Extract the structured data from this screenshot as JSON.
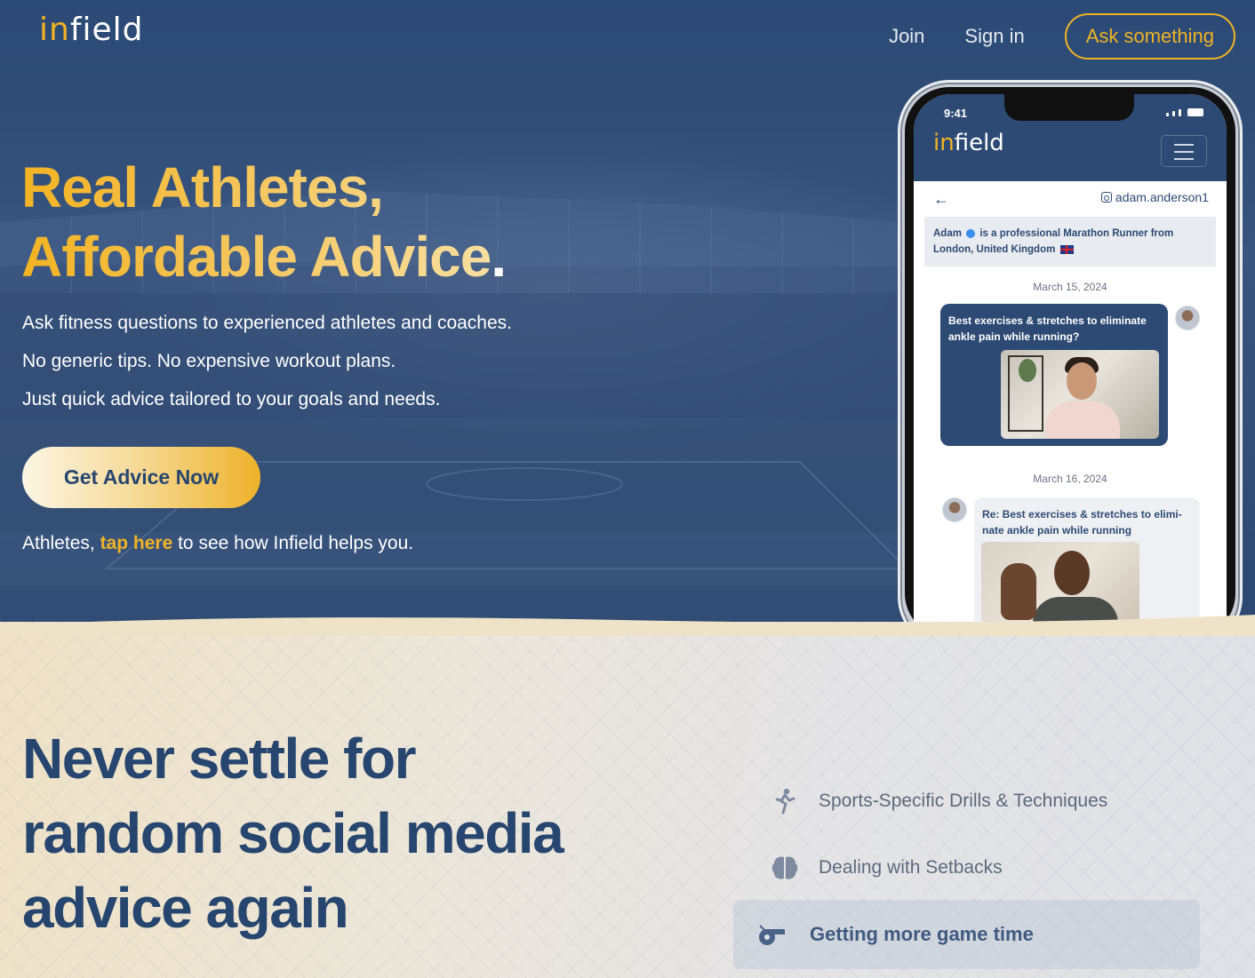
{
  "brand": {
    "logo_prefix": "in",
    "logo_rest": "field",
    "accent": "#f0b326",
    "navy": "#27466f"
  },
  "nav": {
    "join": "Join",
    "signin": "Sign in",
    "ask": "Ask something"
  },
  "hero": {
    "headline_line1": "Real Athletes,",
    "headline_line2": "Affordable Advice",
    "headline_dot": ".",
    "sub1": "Ask fitness questions to experienced athletes and coaches.",
    "sub2": "No generic tips. No expensive workout plans.",
    "sub3": "Just quick advice tailored to your goals and needs.",
    "cta": "Get Advice Now",
    "athletes_pre": "Athletes, ",
    "athletes_link": "tap here",
    "athletes_post": " to see how Infield helps you."
  },
  "phone": {
    "time": "9:41",
    "logo_prefix": "in",
    "logo_rest": "field",
    "handle": "adam.anderson1",
    "bio_name": "Adam",
    "bio_text": "is a professional Marathon Runner from London, United Kingdom",
    "date1": "March 15, 2024",
    "question": "Best exercises & stretches to eliminate ankle pain while running?",
    "date2": "March 16, 2024",
    "reply": "Re: Best exercises & stretches to elimi-nate ankle pain while running"
  },
  "lower": {
    "headline_line1": "Never settle for",
    "headline_line2": "random social media",
    "headline_line3": "advice again",
    "features": [
      {
        "label": "Sports-Specific Drills & Techniques",
        "icon": "runner-icon"
      },
      {
        "label": "Dealing with Setbacks",
        "icon": "brain-icon"
      },
      {
        "label": "Getting more game time",
        "icon": "whistle-icon"
      }
    ]
  }
}
